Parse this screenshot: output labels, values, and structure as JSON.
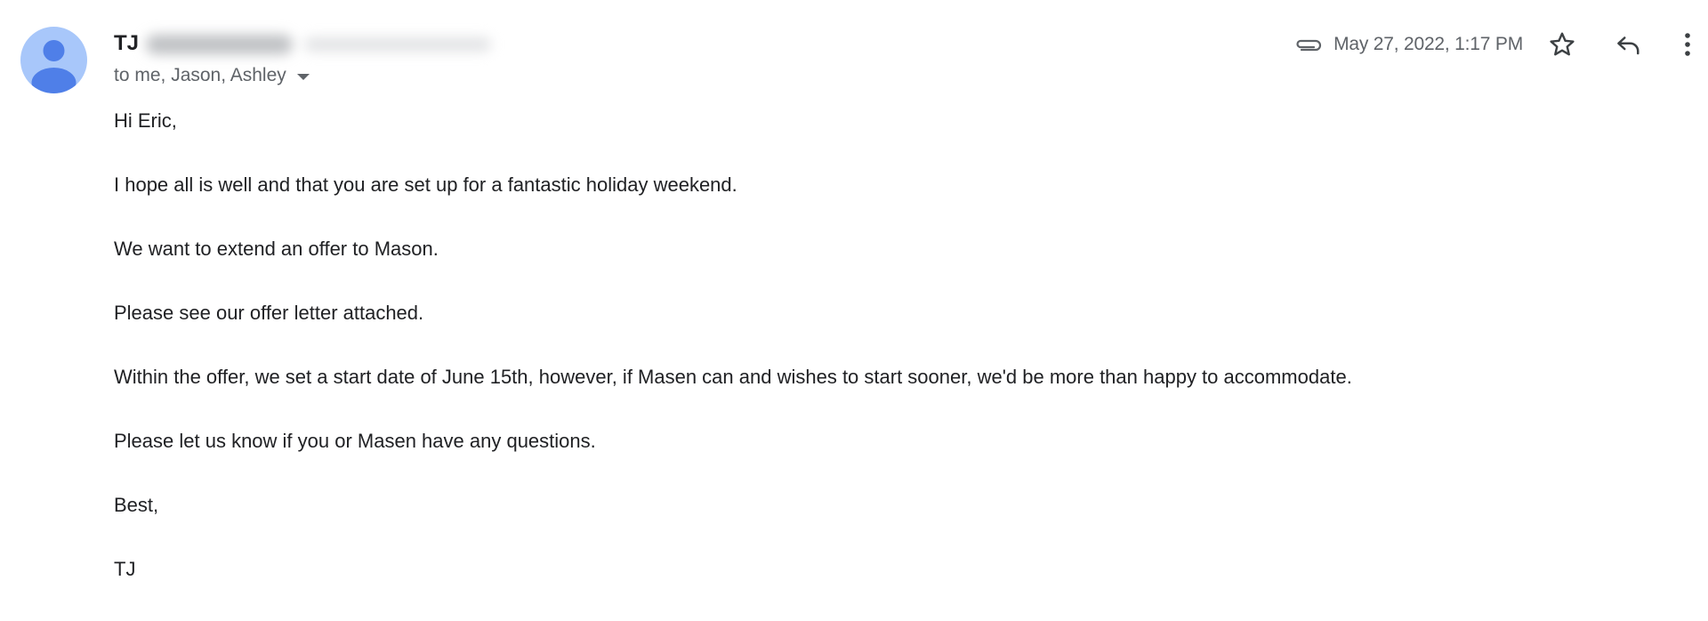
{
  "email": {
    "sender_name": "TJ",
    "recipients": "to me, Jason, Ashley",
    "date": "May 27, 2022, 1:17 PM",
    "body": {
      "greeting": "Hi Eric,",
      "paragraph_1": "I hope all is well and that you are set up for a fantastic holiday weekend.",
      "paragraph_2": "We want to extend an offer to Mason.",
      "paragraph_3": "Please see our offer letter attached.",
      "paragraph_4": "Within the offer, we set a start date of June 15th, however, if Masen can and wishes to start sooner, we'd be more than happy to accommodate.",
      "paragraph_5": "Please let us know if you or Masen have any questions.",
      "signoff": "Best,",
      "signature": "TJ"
    }
  },
  "icons": {
    "avatar": "person-avatar-icon",
    "attachment": "paperclip-icon",
    "star": "star-outline-icon",
    "reply": "reply-icon",
    "more": "more-vert-icon",
    "recipients_dropdown": "caret-down-icon"
  },
  "colors": {
    "avatar_bg": "#a8c7fa",
    "avatar_figure": "#4f7fe8",
    "primary_text": "#202124",
    "secondary_text": "#5f6368"
  }
}
